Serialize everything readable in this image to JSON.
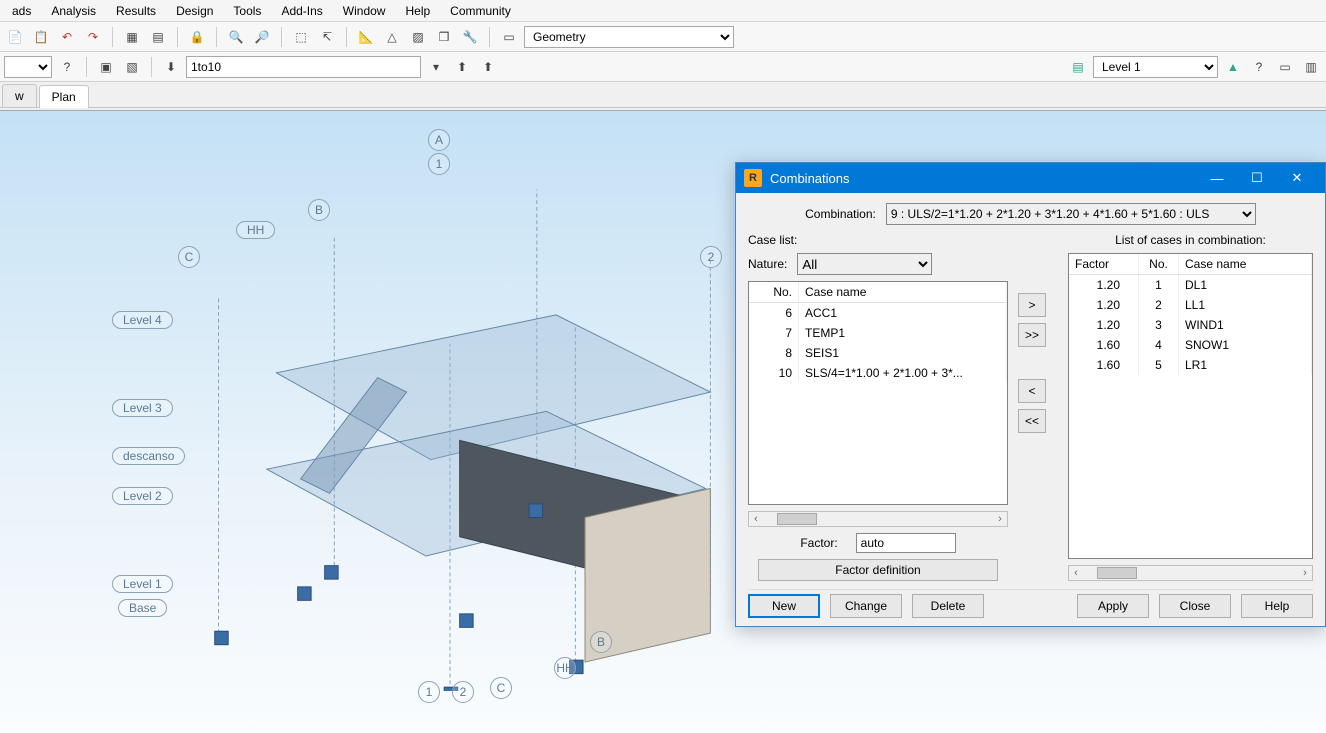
{
  "menu": {
    "items": [
      "ads",
      "Analysis",
      "Results",
      "Design",
      "Tools",
      "Add-Ins",
      "Window",
      "Help",
      "Community"
    ]
  },
  "toolbar1": {
    "combo_label": "Geometry",
    "icons": [
      "doc",
      "paste",
      "undo",
      "redo",
      "calendar",
      "grid",
      "lock",
      "zoom",
      "zoom-plus",
      "select",
      "axis",
      "measure",
      "section",
      "analyze",
      "cube",
      "wrench",
      "layers",
      "window"
    ]
  },
  "toolbar2": {
    "selection": "",
    "help_icon": "?",
    "list_value": "1to10",
    "level_value": "Level 1"
  },
  "tabs": {
    "items": [
      "w",
      "Plan"
    ],
    "active": 1
  },
  "viewport": {
    "grid_circles": [
      "A",
      "1",
      "B",
      "C",
      "2",
      "B",
      "HH",
      "1",
      "2",
      "C"
    ],
    "level_labels": [
      "HH",
      "Level 4",
      "Level 3",
      "descanso",
      "Level 2",
      "Level 1",
      "Base"
    ]
  },
  "dialog": {
    "title": "Combinations",
    "combination_label": "Combination:",
    "combination_value": "9 : ULS/2=1*1.20 + 2*1.20 + 3*1.20 + 4*1.60 + 5*1.60 : ULS",
    "case_list_label": "Case list:",
    "list_cases_label": "List of cases in combination:",
    "nature_label": "Nature:",
    "nature_value": "All",
    "case_headers": {
      "no": "No.",
      "name": "Case name"
    },
    "cases": [
      {
        "no": "6",
        "name": "ACC1"
      },
      {
        "no": "7",
        "name": "TEMP1"
      },
      {
        "no": "8",
        "name": "SEIS1"
      },
      {
        "no": "10",
        "name": "SLS/4=1*1.00 + 2*1.00 + 3*..."
      }
    ],
    "comb_headers": {
      "factor": "Factor",
      "no": "No.",
      "name": "Case name"
    },
    "comb_rows": [
      {
        "factor": "1.20",
        "no": "1",
        "name": "DL1"
      },
      {
        "factor": "1.20",
        "no": "2",
        "name": "LL1"
      },
      {
        "factor": "1.20",
        "no": "3",
        "name": "WIND1"
      },
      {
        "factor": "1.60",
        "no": "4",
        "name": "SNOW1"
      },
      {
        "factor": "1.60",
        "no": "5",
        "name": "LR1"
      }
    ],
    "transfer": {
      "add": ">",
      "add_all": ">>",
      "remove": "<",
      "remove_all": "<<"
    },
    "factor_label": "Factor:",
    "factor_value": "auto",
    "factor_def_btn": "Factor definition",
    "buttons": {
      "new": "New",
      "change": "Change",
      "delete": "Delete",
      "apply": "Apply",
      "close": "Close",
      "help": "Help"
    }
  }
}
